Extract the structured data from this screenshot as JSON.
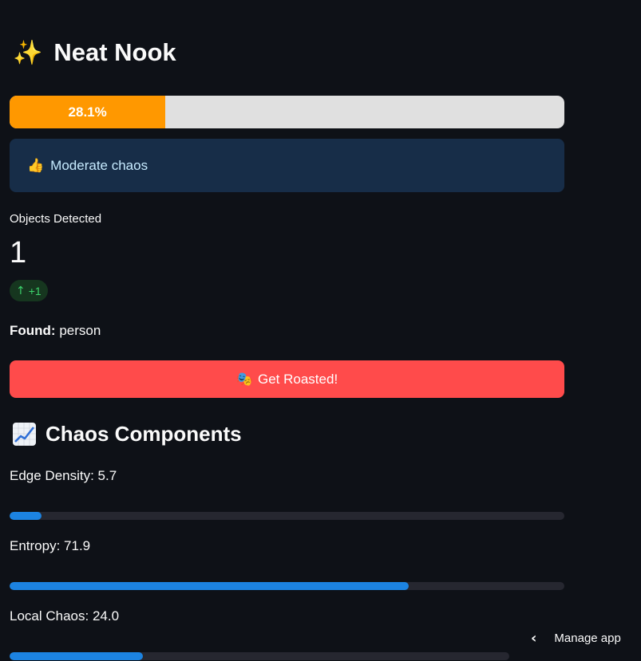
{
  "header": {
    "title_icon": "✨",
    "title": "Neat Nook"
  },
  "score": {
    "percent": 28.1,
    "label": "28.1%",
    "fill_color": "#ff9800",
    "track_color": "#e0e0e0"
  },
  "status": {
    "icon": "👍",
    "text": "Moderate chaos"
  },
  "metric": {
    "label": "Objects Detected",
    "value": "1",
    "delta_icon": "↑",
    "delta": "+1"
  },
  "found": {
    "label": "Found:",
    "value": "person"
  },
  "roast_button": {
    "icon": "🎭",
    "label": "Get Roasted!"
  },
  "components": {
    "icon": "chart-increasing-icon",
    "title": "Chaos Components",
    "items": [
      {
        "label": "Edge Density: 5.7",
        "value": 5.7
      },
      {
        "label": "Entropy: 71.9",
        "value": 71.9
      },
      {
        "label": "Local Chaos: 24.0",
        "value": 24.0
      }
    ]
  },
  "manage_app": {
    "icon": "‹",
    "label": "Manage app"
  },
  "colors": {
    "background": "#0e1117",
    "info_bg": "#172d48",
    "button": "#ff4b4b",
    "bar_fill": "#1c83e1"
  }
}
